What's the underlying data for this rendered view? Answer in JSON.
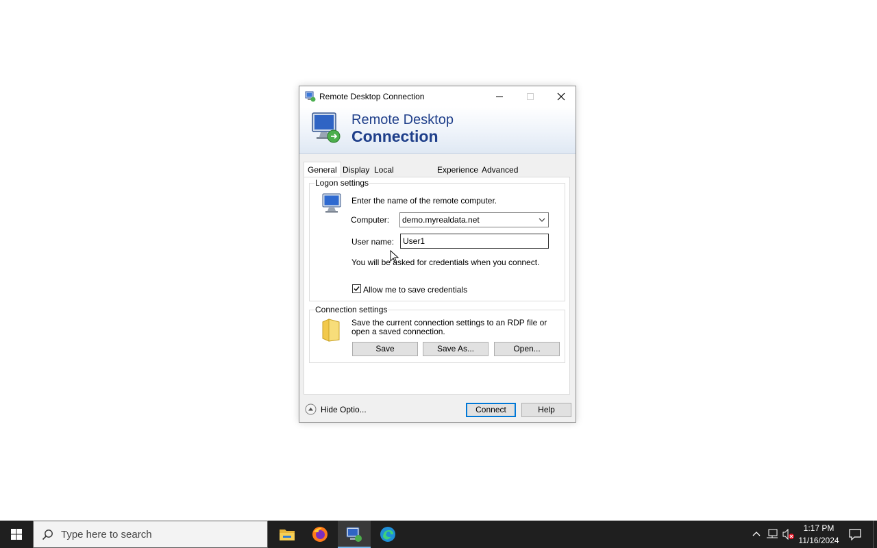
{
  "window": {
    "title": "Remote Desktop Connection",
    "banner_line1": "Remote Desktop",
    "banner_line2": "Connection"
  },
  "tabs": [
    {
      "label": "General",
      "active": true
    },
    {
      "label": "Display"
    },
    {
      "label": "Local Resources"
    },
    {
      "label": "Experience"
    },
    {
      "label": "Advanced"
    }
  ],
  "logon": {
    "group_title": "Logon settings",
    "instruction": "Enter the name of the remote computer.",
    "computer_label": "Computer:",
    "computer_value": "demo.myrealdata.net",
    "username_label": "User name:",
    "username_value": "User1",
    "credentials_note": "You will be asked for credentials when you connect.",
    "save_credentials_label": "Allow me to save credentials",
    "save_credentials_checked": true
  },
  "connection": {
    "group_title": "Connection settings",
    "description": "Save the current connection settings to an RDP file or open a saved connection.",
    "save_label": "Save",
    "save_as_label": "Save As...",
    "open_label": "Open..."
  },
  "footer": {
    "hide_options_label": "Hide Optio...",
    "connect_label": "Connect",
    "help_label": "Help"
  },
  "taskbar": {
    "search_placeholder": "Type here to search",
    "apps": [
      "file-explorer-icon",
      "firefox-icon",
      "remote-desktop-icon",
      "edge-icon"
    ],
    "time": "1:17 PM",
    "date": "11/16/2024"
  },
  "colors": {
    "banner_text": "#1f3f8a",
    "taskbar": "#1f1f1f",
    "focus_blue": "#0078d7"
  }
}
